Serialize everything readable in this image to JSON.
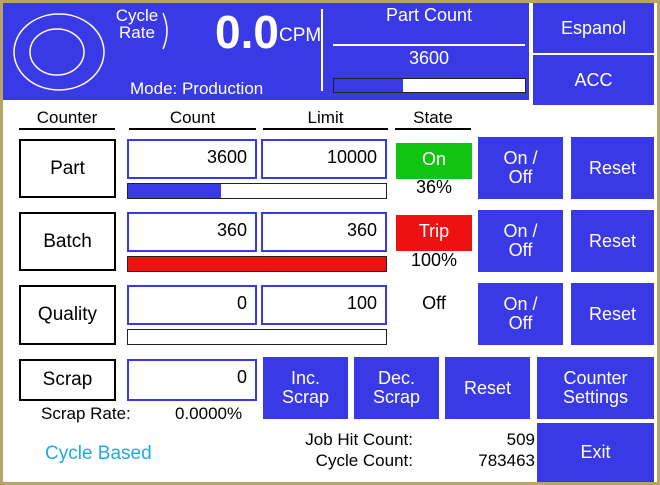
{
  "header": {
    "cycle_rate_label_1": "Cycle",
    "cycle_rate_label_2": "Rate",
    "rate_value": "0.0",
    "rate_unit": "CPM",
    "mode": "Mode: Production",
    "part_count_title": "Part Count",
    "part_count_value": "3600",
    "part_count_progress": 0.36,
    "language_button": "Espanol",
    "acc_button": "ACC"
  },
  "columns": {
    "counter": "Counter",
    "count": "Count",
    "limit": "Limit",
    "state": "State"
  },
  "rows": {
    "part": {
      "label": "Part",
      "count": "3600",
      "limit": "10000",
      "state": "On",
      "percent": "36%",
      "progress": 0.36,
      "bar_color": "#3a39e6",
      "state_color": "#12c412",
      "onoff": "On /\nOff",
      "reset": "Reset"
    },
    "batch": {
      "label": "Batch",
      "count": "360",
      "limit": "360",
      "state": "Trip",
      "percent": "100%",
      "progress": 1.0,
      "bar_color": "#ee1111",
      "state_color": "#ee1111",
      "onoff": "On /\nOff",
      "reset": "Reset"
    },
    "quality": {
      "label": "Quality",
      "count": "0",
      "limit": "100",
      "state": "Off",
      "progress": 0.0,
      "onoff": "On /\nOff",
      "reset": "Reset"
    }
  },
  "scrap": {
    "label": "Scrap",
    "count": "0",
    "rate_label": "Scrap Rate:",
    "rate_value": "0.0000%",
    "inc_button": "Inc.\nScrap",
    "dec_button": "Dec.\nScrap",
    "reset_button": "Reset"
  },
  "footer": {
    "cycle_based": "Cycle Based",
    "job_hit_label": "Job Hit Count:",
    "job_hit_value": "509",
    "cycle_count_label": "Cycle Count:",
    "cycle_count_value": "783463",
    "counter_settings_button": "Counter\nSettings",
    "exit_button": "Exit"
  },
  "colors": {
    "button_blue": "#3a39e6",
    "on_green": "#12c412",
    "trip_red": "#ee1111",
    "cycle_based_text": "#1eaae8",
    "frame": "#b8a36a"
  }
}
